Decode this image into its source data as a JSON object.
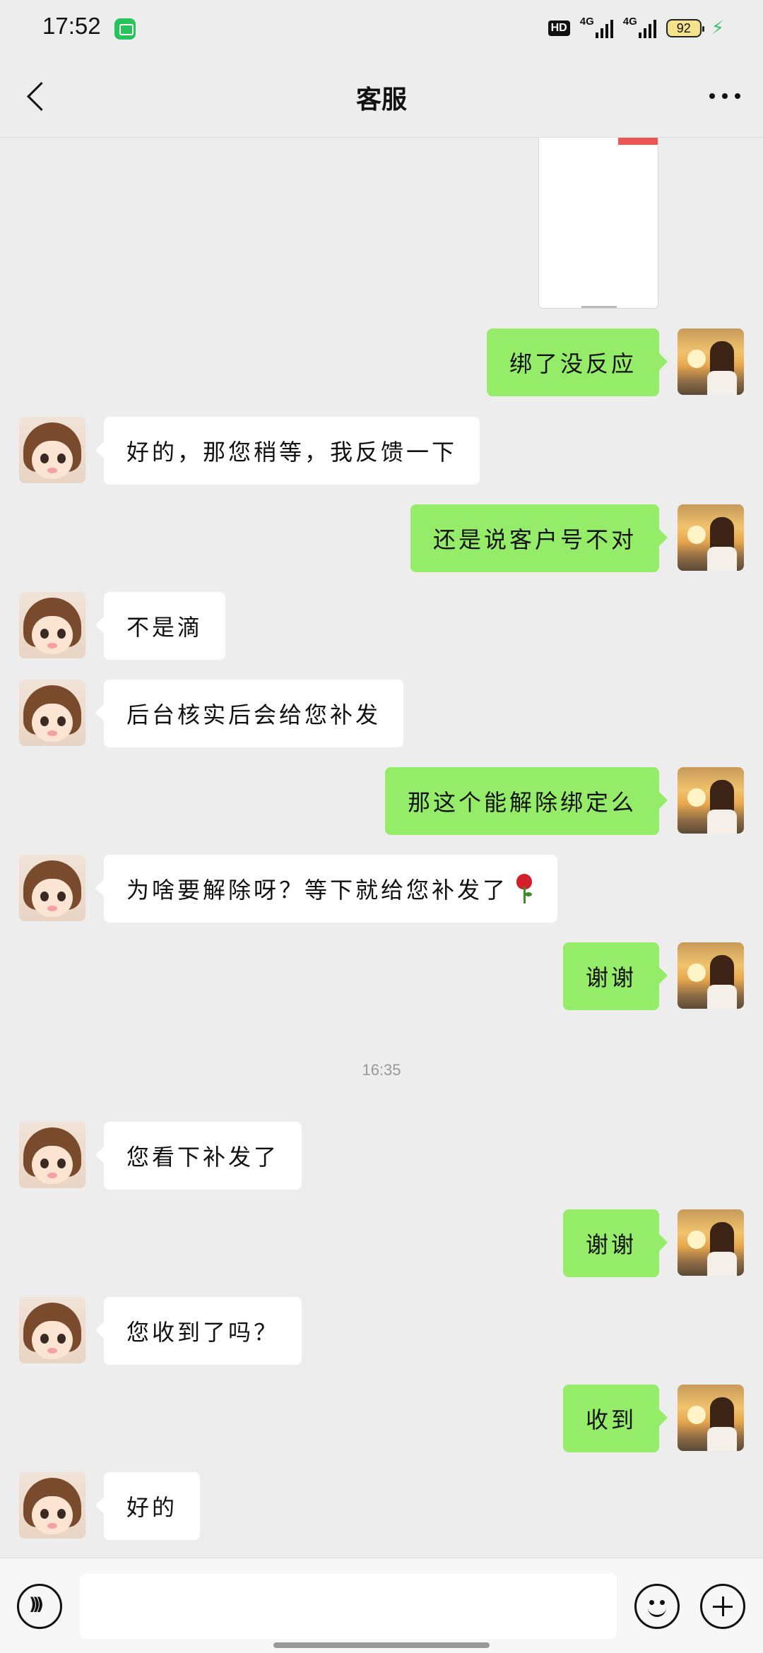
{
  "status_bar": {
    "time": "17:52",
    "network_1": "4G",
    "network_2": "4G",
    "hd_label": "HD",
    "battery": "92"
  },
  "nav": {
    "title": "客服",
    "back_icon": "chevron-left-icon",
    "more_icon": "more-dots-icon"
  },
  "messages": [
    {
      "side": "right",
      "text": "绑了没反应"
    },
    {
      "side": "left",
      "text": "好的，那您稍等，我反馈一下"
    },
    {
      "side": "right",
      "text": "还是说客户号不对"
    },
    {
      "side": "left",
      "text": "不是滴"
    },
    {
      "side": "left",
      "text": "后台核实后会给您补发"
    },
    {
      "side": "right",
      "text": "那这个能解除绑定么"
    },
    {
      "side": "left",
      "text": "为啥要解除呀？等下就给您补发了",
      "emoji": "rose"
    },
    {
      "side": "right",
      "text": "谢谢"
    },
    {
      "side": "left",
      "text": "您看下补发了"
    },
    {
      "side": "right",
      "text": "谢谢"
    },
    {
      "side": "left",
      "text": "您收到了吗？"
    },
    {
      "side": "right",
      "text": "收到"
    },
    {
      "side": "left",
      "text": "好的"
    }
  ],
  "timestamp": "16:35",
  "input_bar": {
    "voice_icon": "voice-icon",
    "text_value": "",
    "emoji_icon": "emoji-icon",
    "plus_icon": "plus-icon"
  },
  "colors": {
    "background": "#ededed",
    "bubble_self": "#95ec69",
    "bubble_other": "#ffffff"
  }
}
